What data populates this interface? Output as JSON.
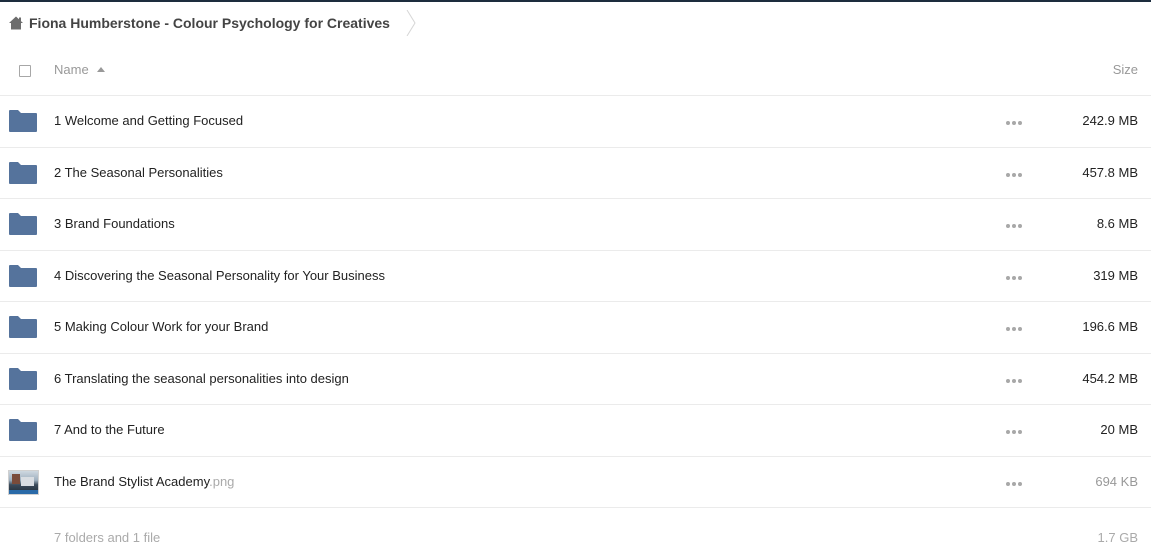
{
  "breadcrumb": {
    "title": "Fiona Humberstone - Colour Psychology for Creatives",
    "home_icon": "home-icon"
  },
  "header": {
    "name_label": "Name",
    "size_label": "Size",
    "sort": "ascending"
  },
  "items": [
    {
      "name": "1 Welcome and Getting Focused",
      "ext": "",
      "size": "242.9 MB",
      "type": "folder"
    },
    {
      "name": "2 The Seasonal Personalities",
      "ext": "",
      "size": "457.8 MB",
      "type": "folder"
    },
    {
      "name": "3 Brand Foundations",
      "ext": "",
      "size": "8.6 MB",
      "type": "folder"
    },
    {
      "name": "4 Discovering the Seasonal Personality for Your Business",
      "ext": "",
      "size": "319 MB",
      "type": "folder"
    },
    {
      "name": "5 Making Colour Work for your Brand",
      "ext": "",
      "size": "196.6 MB",
      "type": "folder"
    },
    {
      "name": "6 Translating the seasonal personalities into design",
      "ext": "",
      "size": "454.2 MB",
      "type": "folder"
    },
    {
      "name": "7 And to the Future",
      "ext": "",
      "size": "20 MB",
      "type": "folder"
    },
    {
      "name": "The Brand Stylist Academy",
      "ext": ".png",
      "size": "694 KB",
      "type": "file"
    }
  ],
  "summary": {
    "count": "7 folders and 1 file",
    "total": "1.7 GB"
  },
  "colors": {
    "folder": "#55739c",
    "top_border": "#1d2d3e",
    "divider": "#ebebeb",
    "muted_text": "#999999"
  }
}
